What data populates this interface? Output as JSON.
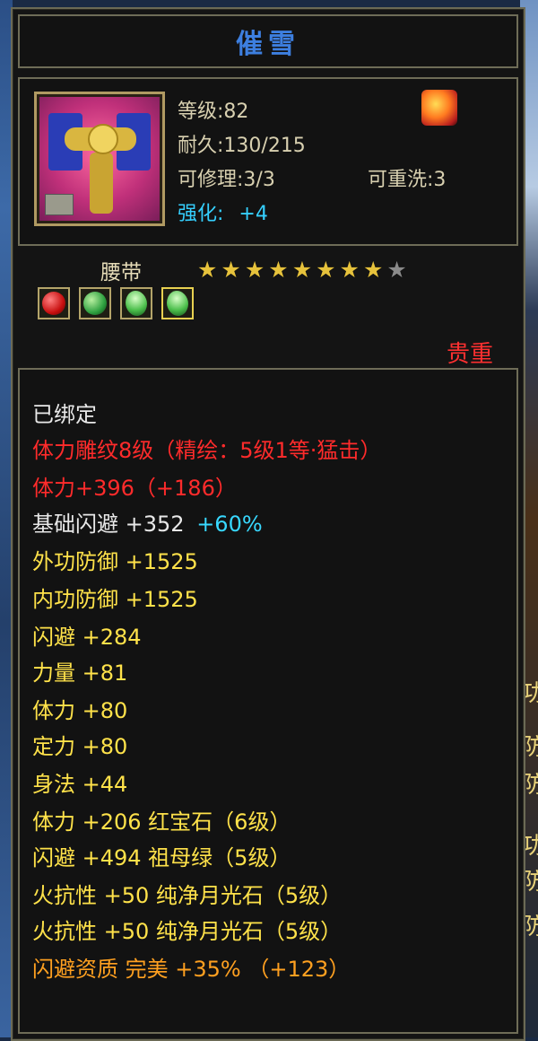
{
  "item": {
    "name": "催雪",
    "level_label": "等级:82",
    "durability_label": "耐久:130/215",
    "repair_label": "可修理:3/3",
    "rewash_label": "可重洗:3",
    "enhance_label": "强化:",
    "enhance_value": "+4",
    "type": "腰带",
    "stars_total": 9,
    "stars_filled": 8,
    "rarity": "贵重",
    "gems": [
      {
        "name": "ruby-gem",
        "color": "#c81010"
      },
      {
        "name": "emerald-gem",
        "color": "#2ea040"
      },
      {
        "name": "moonstone-gem",
        "color": "#4cbf4c"
      },
      {
        "name": "moonstone-gem-selected",
        "color": "#4cbf4c"
      }
    ]
  },
  "attributes": {
    "bound": "已绑定",
    "engrave": "体力雕纹8级（精绘：5级1等·猛击）",
    "stamina_total": "体力+396（+186）",
    "base_dodge": "基础闪避 +352",
    "base_dodge_pct": "+60%",
    "ext_defense": "外功防御 +1525",
    "int_defense": "内功防御 +1525",
    "dodge": "闪避 +284",
    "strength": "力量 +81",
    "stamina": "体力 +80",
    "focus": "定力 +80",
    "agility": "身法 +44",
    "gem_stamina": "体力 +206 红宝石（6级）",
    "gem_dodge": "闪避 +494 祖母绿（5级）",
    "gem_fire1": "火抗性 +50 纯净月光石（5级）",
    "gem_fire2": "火抗性 +50 纯净月光石（5级）",
    "aptitude": "闪避资质  完美 +35% （+123）"
  },
  "colors": {
    "title": "#3d7fe0",
    "enhance": "#35d0ff",
    "rarity": "#ff3030",
    "white": "#e8e8e8",
    "red": "#ff2b2b",
    "yellow": "#ffe24a",
    "cyan": "#38d8ff",
    "orange": "#ffa020"
  },
  "side_text": [
    "功",
    "防",
    "防",
    "功",
    "防",
    "防"
  ]
}
